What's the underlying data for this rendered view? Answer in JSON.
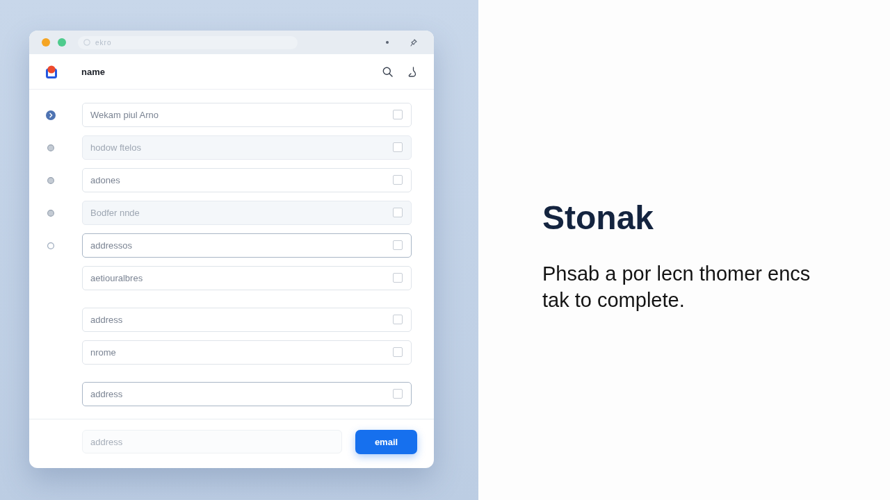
{
  "window": {
    "traffic_lights": [
      {
        "color": "#f5a524"
      },
      {
        "color": "#4ecb8d"
      }
    ],
    "address_bar": {
      "text": "ekro"
    }
  },
  "header": {
    "title": "name"
  },
  "field_groups": [
    {
      "fields": [
        {
          "placeholder": "Wekam piul Arno",
          "indicator": {
            "kind": "active"
          },
          "disabled": false,
          "focused": false,
          "checked": false
        },
        {
          "placeholder": "hodow ftelos",
          "indicator": {
            "kind": "filled"
          },
          "disabled": true,
          "focused": false,
          "checked": false
        },
        {
          "placeholder": "adones",
          "indicator": {
            "kind": "filled"
          },
          "disabled": false,
          "focused": false,
          "checked": false
        },
        {
          "placeholder": "Bodfer nnde",
          "indicator": {
            "kind": "filled"
          },
          "disabled": true,
          "focused": false,
          "checked": false
        },
        {
          "placeholder": "addressos",
          "indicator": {
            "kind": "outline"
          },
          "disabled": false,
          "focused": true,
          "checked": false
        },
        {
          "placeholder": "aetiouralbres",
          "disabled": false,
          "focused": false,
          "checked": false
        }
      ]
    },
    {
      "fields": [
        {
          "placeholder": "address",
          "disabled": false,
          "focused": false,
          "checked": false
        },
        {
          "placeholder": "nrome",
          "disabled": false,
          "focused": false,
          "checked": false
        }
      ]
    },
    {
      "fields": [
        {
          "placeholder": "address",
          "disabled": false,
          "focused": true,
          "checked": false
        }
      ]
    }
  ],
  "footer": {
    "input": {
      "placeholder": "address"
    },
    "button": "email"
  },
  "side": {
    "heading": "Stonak",
    "text": "Phsab a por lecn thomer encs tak to complete."
  }
}
